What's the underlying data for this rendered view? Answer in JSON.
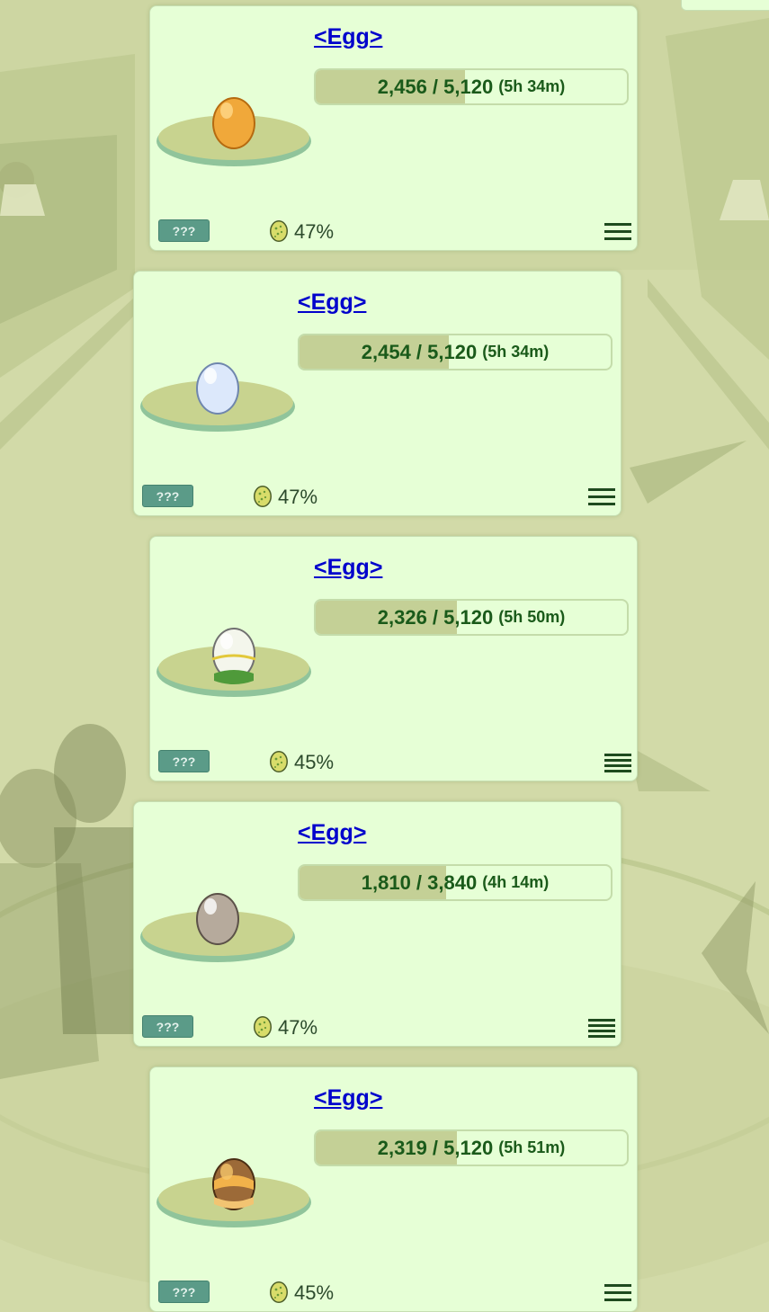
{
  "eggs": [
    {
      "name": "<Egg>",
      "exp_text": "2,456 / 5,120",
      "time": "(5h 34m)",
      "progress": 0.48,
      "badge": "???",
      "percent": "47%",
      "egg_color": "orange"
    },
    {
      "name": "<Egg>",
      "exp_text": "2,454 / 5,120",
      "time": "(5h 34m)",
      "progress": 0.48,
      "badge": "???",
      "percent": "47%",
      "egg_color": "light-blue"
    },
    {
      "name": "<Egg>",
      "exp_text": "2,326 / 5,120",
      "time": "(5h 50m)",
      "progress": 0.454,
      "badge": "???",
      "percent": "45%",
      "egg_color": "white-green"
    },
    {
      "name": "<Egg>",
      "exp_text": "1,810 / 3,840",
      "time": "(4h 14m)",
      "progress": 0.471,
      "badge": "???",
      "percent": "47%",
      "egg_color": "grey"
    },
    {
      "name": "<Egg>",
      "exp_text": "2,319 / 5,120",
      "time": "(5h 51m)",
      "progress": 0.453,
      "badge": "???",
      "percent": "45%",
      "egg_color": "brown-orange"
    }
  ],
  "icons": {
    "menu": "hamburger-menu-icon",
    "percent": "egg-icon",
    "plate": "egg-plate"
  },
  "colors": {
    "card_bg": "#e6ffd6",
    "progress_fill": "#c4d096",
    "link": "#0000cc",
    "badge": "#5b9b88",
    "text_dark_green": "#1a5a1a"
  }
}
